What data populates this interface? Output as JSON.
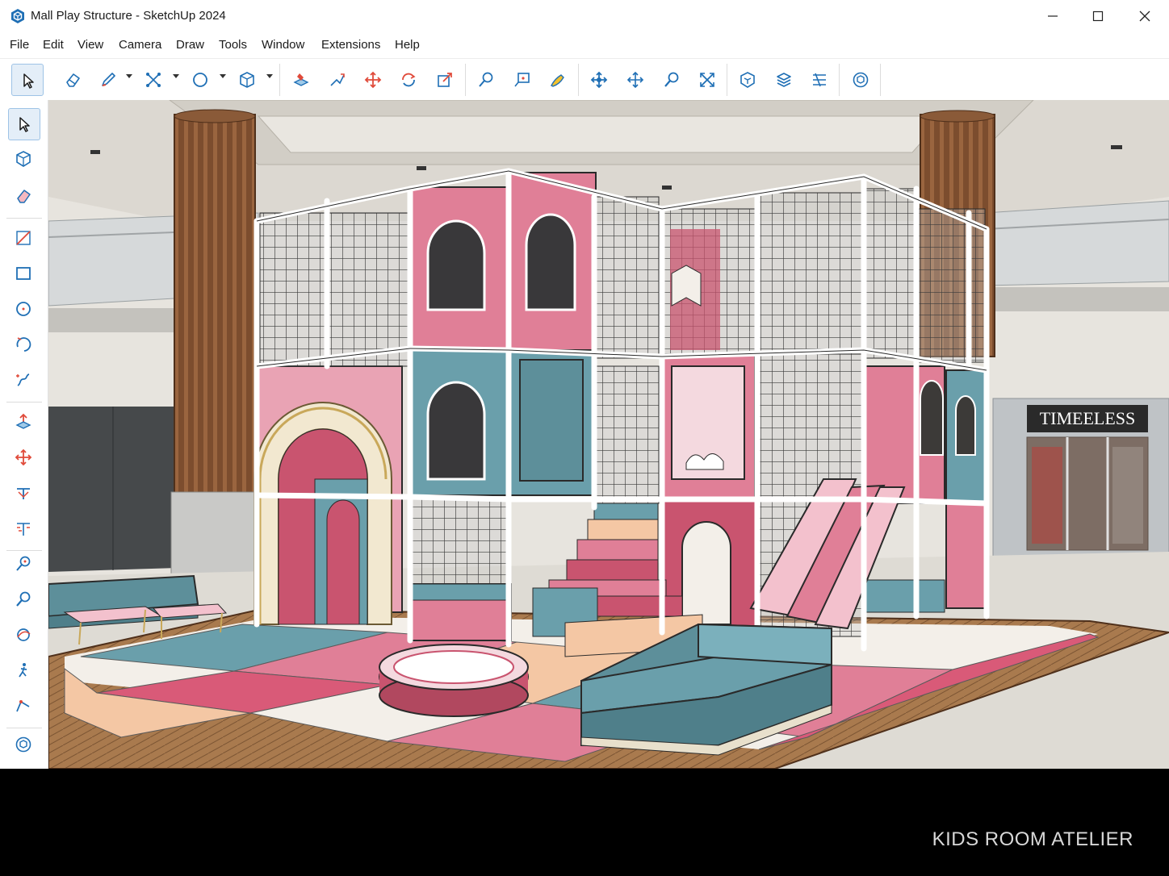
{
  "window": {
    "title": "Mall Play Structure - SketchUp 2024",
    "controls": [
      "minimize",
      "maximize",
      "close"
    ]
  },
  "menu": [
    "File",
    "Edit",
    "View",
    "Camera",
    "Draw",
    "Tools",
    "Window",
    "Extensions",
    "Help"
  ],
  "toolbar": {
    "tools": [
      "select-icon",
      "eraser-icon",
      "pencil-icon",
      "arc-points-icon",
      "circle-icon",
      "box-icon",
      "paint-bucket-icon",
      "follow-me-icon",
      "move-icon",
      "rotate-icon",
      "scale-icon",
      "tape-measure-icon",
      "dimension-icon",
      "paint-brush-icon",
      "orbit-icon",
      "pan-icon",
      "zoom-icon",
      "zoom-extents-icon",
      "components-icon",
      "layers-icon",
      "styles-icon",
      "warehouse-icon"
    ]
  },
  "left_toolbar": {
    "tools": [
      "select-icon",
      "make-component-icon",
      "eraser-icon",
      "line-icon",
      "rectangle-icon",
      "circle-icon",
      "arc-icon",
      "freehand-icon",
      "push-pull-icon",
      "move-icon",
      "rotate-icon",
      "scale-icon",
      "tape-measure-icon",
      "zoom-icon",
      "orbit-icon",
      "walk-icon",
      "position-camera-icon",
      "warehouse-icon"
    ]
  },
  "viewport": {
    "storefront_sign": "TIMEELESS",
    "colors": {
      "pink": "#e07f97",
      "deep_pink": "#c9546f",
      "teal": "#6a9fab",
      "peach": "#f4c7a4",
      "wood": "#8a5a38",
      "floor": "#e9e7e3"
    }
  },
  "caption": "KIDS ROOM ATELIER",
  "colors": {
    "accent_blue": "#1f6fb5",
    "active_tool_bg": "#e4eef8",
    "background": "#000000"
  }
}
